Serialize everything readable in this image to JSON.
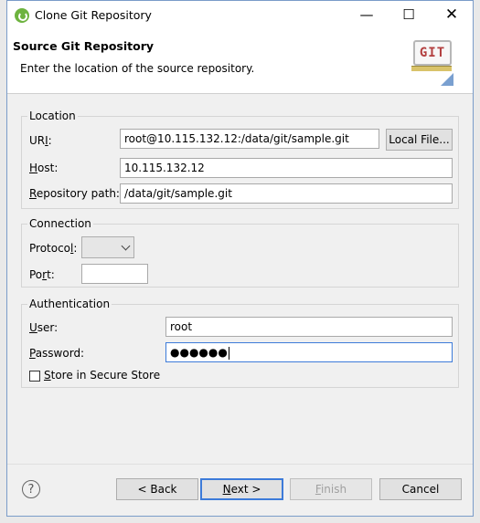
{
  "window": {
    "title": "Clone Git Repository",
    "min_glyph": "—",
    "max_glyph": "☐",
    "close_glyph": "✕"
  },
  "header": {
    "title": "Source Git Repository",
    "description": "Enter the location of the source repository.",
    "logo_text": "GIT"
  },
  "location": {
    "legend": "Location",
    "uri": {
      "label_pre": "UR",
      "label_key": "I",
      "label_post": ":",
      "value": "root@10.115.132.12:/data/git/sample.git"
    },
    "local_file_button": "Local File...",
    "host": {
      "label_key": "H",
      "label_post": "ost:",
      "value": "10.115.132.12"
    },
    "repo_path": {
      "label_key": "R",
      "label_post": "epository path:",
      "value": "/data/git/sample.git"
    }
  },
  "connection": {
    "legend": "Connection",
    "protocol": {
      "label_pre": "Protoco",
      "label_key": "l",
      "label_post": ":",
      "value": ""
    },
    "port": {
      "label_pre": "Po",
      "label_key": "r",
      "label_post": "t:",
      "value": ""
    }
  },
  "authentication": {
    "legend": "Authentication",
    "user": {
      "label_key": "U",
      "label_post": "ser:",
      "value": "root"
    },
    "password": {
      "label_key": "P",
      "label_post": "assword:",
      "value": "●●●●●●"
    },
    "secure_store": {
      "label_key": "S",
      "label_post": "tore in Secure Store",
      "checked": false
    }
  },
  "footer": {
    "help_glyph": "?",
    "back_button": "< Back",
    "next_button_key": "N",
    "next_button_post": "ext >",
    "finish_button_key": "F",
    "finish_button_post": "inish",
    "cancel_button": "Cancel"
  }
}
